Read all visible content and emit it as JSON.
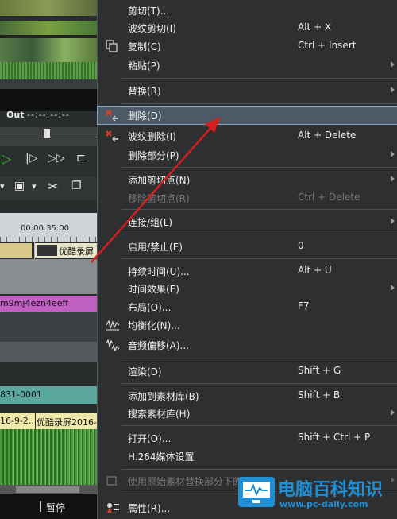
{
  "editor": {
    "out_label": "Out",
    "out_timecode": "--:--:--:--",
    "ruler_time": "00:00:35:00",
    "clip_title": "优酷录屏",
    "filename": "m9mj4ezn4eeff",
    "clip_id": "831-0001",
    "clip_dates": "16-9-2...",
    "clip_title_2": "优酷录屏2016-",
    "status": "暂停"
  },
  "menu": {
    "items": [
      {
        "label": "剪切(T)...",
        "shortcut": ""
      },
      {
        "label": "波纹剪切(I)",
        "shortcut": "Alt + X"
      },
      {
        "label": "复制(C)",
        "shortcut": "Ctrl + Insert"
      },
      {
        "label": "粘贴(P)",
        "shortcut": ""
      },
      {
        "label": "替换(R)",
        "shortcut": ""
      },
      {
        "label": "删除(D)",
        "shortcut": ""
      },
      {
        "label": "波纹删除(I)",
        "shortcut": "Alt + Delete"
      },
      {
        "label": "删除部分(P)",
        "shortcut": ""
      },
      {
        "label": "添加剪切点(N)",
        "shortcut": ""
      },
      {
        "label": "移除剪切点(R)",
        "shortcut": "Ctrl + Delete"
      },
      {
        "label": "连接/组(L)",
        "shortcut": ""
      },
      {
        "label": "启用/禁止(E)",
        "shortcut": "0"
      },
      {
        "label": "持续时间(U)...",
        "shortcut": "Alt + U"
      },
      {
        "label": "时间效果(E)",
        "shortcut": ""
      },
      {
        "label": "布局(O)...",
        "shortcut": "F7"
      },
      {
        "label": "均衡化(N)...",
        "shortcut": ""
      },
      {
        "label": "音频偏移(A)...",
        "shortcut": ""
      },
      {
        "label": "渲染(D)",
        "shortcut": "Shift + G"
      },
      {
        "label": "添加到素材库(B)",
        "shortcut": "Shift + B"
      },
      {
        "label": "搜索素材库(H)",
        "shortcut": ""
      },
      {
        "label": "打开(O)...",
        "shortcut": "Shift + Ctrl + P"
      },
      {
        "label": "H.264媒体设置",
        "shortcut": ""
      },
      {
        "label": "使用原始素材替换部分下的素材(R)",
        "shortcut": ""
      },
      {
        "label": "属性(R)...",
        "shortcut": ""
      }
    ]
  },
  "watermark": {
    "name": "电脑百科知识",
    "url": "www.pc-daily.com"
  },
  "colors": {
    "menu_bg": "#2d2f30",
    "highlight": "#4b5a66",
    "arrow": "#d02020",
    "watermark_blue": "#1f8fd6"
  }
}
